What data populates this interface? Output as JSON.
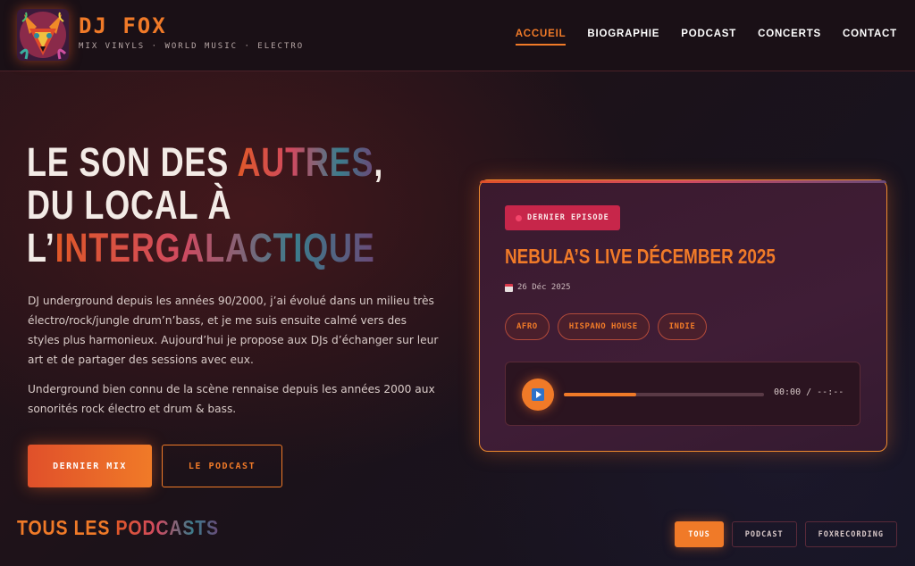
{
  "header": {
    "brand_title": "DJ FOX",
    "brand_subtitle": "MIX VINYLS · WORLD MUSIC · ELECTRO",
    "logo_icon": "fox-art-logo",
    "nav": [
      {
        "label": "ACCUEIL",
        "active": true
      },
      {
        "label": "BIOGRAPHIE",
        "active": false
      },
      {
        "label": "PODCAST",
        "active": false
      },
      {
        "label": "CONCERTS",
        "active": false
      },
      {
        "label": "CONTACT",
        "active": false
      }
    ]
  },
  "hero": {
    "title_line1_a": "LE SON DES ",
    "title_line1_b": "AUTRES",
    "title_line1_c": ",",
    "title_line2": "DU LOCAL À",
    "title_line3_a": "L’",
    "title_line3_b": "INTERGALACTIQUE",
    "paragraph1": "DJ underground depuis les années 90/2000, j’ai évolué dans un milieu très électro/rock/jungle drum’n’bass, et je me suis ensuite calmé vers des styles plus harmonieux. Aujourd’hui je propose aux DJs d’échanger sur leur art et de partager des sessions avec eux.",
    "paragraph2": "Underground bien connu de la scène rennaise depuis les années 2000 aux sonorités rock électro et drum & bass.",
    "primary_button": "DERNIER MIX",
    "secondary_button": "LE PODCAST"
  },
  "episode_card": {
    "badge": "DERNIER EPISODE",
    "title": "NEBULA’S LIVE DÉCEMBER 2025",
    "date": "26 Déc 2025",
    "date_icon": "calendar-icon",
    "tags": [
      "AFRO",
      "HISPANO HOUSE",
      "INDIE"
    ],
    "player": {
      "play_icon": "play-icon",
      "progress": 0.36,
      "time": "00:00 / --:--"
    }
  },
  "podcasts": {
    "title_a": "TOUS LES ",
    "title_b": "PODCASTS",
    "filters": [
      {
        "label": "TOUS",
        "active": true
      },
      {
        "label": "PODCAST",
        "active": false
      },
      {
        "label": "FOXRECORDING",
        "active": false
      }
    ]
  },
  "colors": {
    "accent": "#f07a28",
    "badge": "#c7264a",
    "background": "#1c1219"
  }
}
